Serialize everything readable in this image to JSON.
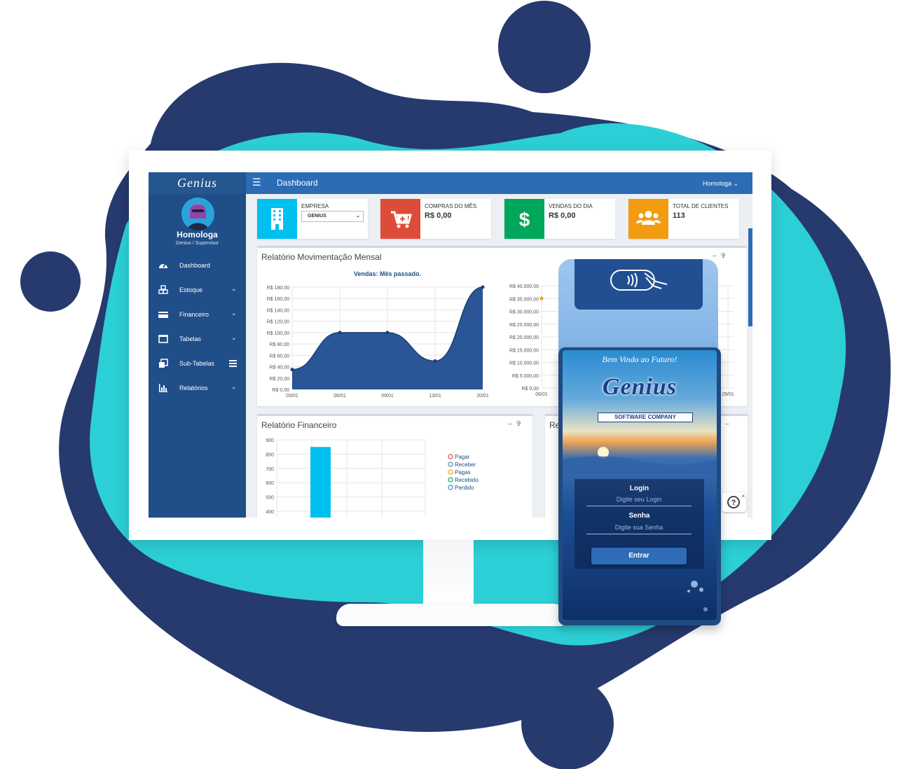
{
  "app": {
    "logo": "Genius"
  },
  "user": {
    "name": "Homologa",
    "role": "Genius / Supervisor",
    "menu_label": "Homologa"
  },
  "header": {
    "title": "Dashboard"
  },
  "sidebar": {
    "items": [
      {
        "label": "Dashboard",
        "icon": "dashboard-icon"
      },
      {
        "label": "Estoque",
        "icon": "cubes-icon"
      },
      {
        "label": "Financeiro",
        "icon": "credit-card-icon"
      },
      {
        "label": "Tabelas",
        "icon": "table-icon"
      },
      {
        "label": "Sub-Tabelas",
        "icon": "clone-icon"
      },
      {
        "label": "Relatórios",
        "icon": "bar-chart-icon"
      }
    ]
  },
  "infoboxes": {
    "empresa": {
      "label": "EMPRESA",
      "selected": "GENIUS",
      "color": "#00c0ef"
    },
    "compras": {
      "label": "COMPRAS DO MÊS",
      "value": "R$ 0,00",
      "color": "#dd4b39"
    },
    "vendas": {
      "label": "VENDAS DO DIA",
      "value": "R$ 0,00",
      "color": "#00a65a"
    },
    "clientes": {
      "label": "TOTAL DE CLIENTES",
      "value": "113",
      "color": "#f39c12"
    }
  },
  "panels": {
    "movimentacao": {
      "title": "Relatório Movimentação Mensal"
    },
    "financeiro": {
      "title": "Relatório Financeiro"
    },
    "third": {
      "title": "Re"
    }
  },
  "chart_data": [
    {
      "type": "area",
      "title": "Vendas: Mês passado.",
      "x": [
        "03/01",
        "06/01",
        "09/01",
        "13/01",
        "20/01"
      ],
      "values": [
        35,
        100,
        100,
        50,
        180
      ],
      "y_ticks": [
        "R$ 180,00",
        "R$ 160,00",
        "R$ 140,00",
        "R$ 120,00",
        "R$ 100,00",
        "R$ 80,00",
        "R$ 60,00",
        "R$ 40,00",
        "R$ 20,00",
        "R$ 0,00"
      ],
      "ylim": [
        0,
        180
      ],
      "color": "#2a5596"
    },
    {
      "type": "line",
      "x_ticks_visible": [
        "06/01",
        "29/01"
      ],
      "y_ticks": [
        "R$ 40.000,00",
        "R$ 35.000,00",
        "R$ 30.000,00",
        "R$ 25.000,00",
        "R$ 20.000,00",
        "R$ 15.000,00",
        "R$ 10.000,00",
        "R$ 5.000,00",
        "R$ 0,00"
      ],
      "ylim": [
        0,
        40000
      ],
      "points": [
        {
          "x": "06/01",
          "y": 35000
        }
      ],
      "color": "#f39c12"
    },
    {
      "type": "bar",
      "y_ticks": [
        "900",
        "800",
        "700",
        "600",
        "500",
        "400"
      ],
      "ylim": [
        400,
        900
      ],
      "bars": [
        {
          "value": 850,
          "color": "#00c0ef"
        }
      ],
      "legend": [
        {
          "label": "Pagar",
          "color": "#dd4b39"
        },
        {
          "label": "Receber",
          "color": "#3c8dbc"
        },
        {
          "label": "Pagas",
          "color": "#f39c12"
        },
        {
          "label": "Recebido",
          "color": "#00a65a"
        },
        {
          "label": "Perdido",
          "color": "#3c8dbc"
        }
      ]
    }
  ],
  "pos": {
    "welcome": "Bem Vindo ao Futuro!",
    "logo": "Genius",
    "tagline": "SOFTWARE COMPANY",
    "login_label": "Login",
    "login_placeholder": "Digite seu Login",
    "password_label": "Senha",
    "password_placeholder": "Digite sua Senha",
    "submit": "Entrar"
  },
  "help": {
    "icon": "help-icon"
  },
  "colors": {
    "dark_blob": "#263a6e",
    "teal_blob": "#24c6d2",
    "sidebar": "#1f4e89",
    "topbar": "#2b6cb4"
  }
}
